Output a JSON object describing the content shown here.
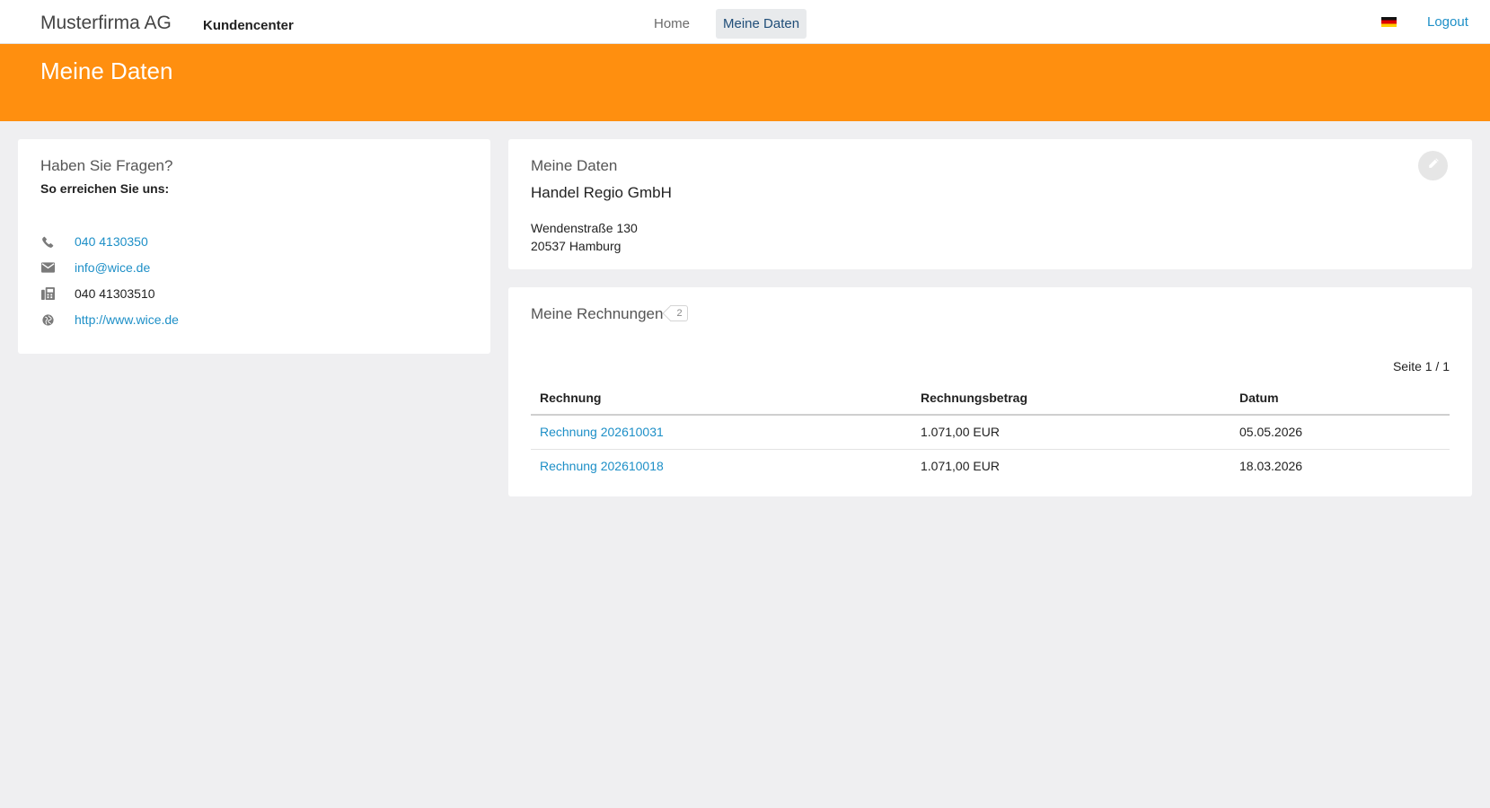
{
  "navbar": {
    "brand": "Musterfirma AG",
    "subbrand": "Kundencenter",
    "links": [
      {
        "label": "Home",
        "active": false
      },
      {
        "label": "Meine Daten",
        "active": true
      }
    ],
    "language_flag": "de-flag-icon",
    "logout": "Logout"
  },
  "header": {
    "title": "Meine Daten",
    "color": "#ff8f0f"
  },
  "contact": {
    "title": "Haben Sie Fragen?",
    "subtitle": "So erreichen Sie uns:",
    "phone": {
      "icon": "phone-icon",
      "value": "040 4130350"
    },
    "email": {
      "icon": "envelope-icon",
      "value": "info@wice.de"
    },
    "fax": {
      "icon": "fax-icon",
      "value": "040 41303510"
    },
    "web": {
      "icon": "globe-icon",
      "value": "http://www.wice.de"
    }
  },
  "profile": {
    "title": "Meine Daten",
    "company": "Handel Regio GmbH",
    "street": "Wendenstraße 130",
    "city": "20537 Hamburg",
    "edit_icon": "pencil-icon"
  },
  "invoices": {
    "title": "Meine Rechnungen",
    "count": "2",
    "pager": "Seite 1 / 1",
    "columns": [
      "Rechnung",
      "Rechnungsbetrag",
      "Datum"
    ],
    "rows": [
      {
        "name": "Rechnung 202610031",
        "amount": "1.071,00 EUR",
        "date": "05.05.2026"
      },
      {
        "name": "Rechnung 202610018",
        "amount": "1.071,00 EUR",
        "date": "18.03.2026"
      }
    ]
  },
  "colors": {
    "accent": "#ff8f0f",
    "link": "#1d8fc7",
    "background": "#efeff1"
  }
}
